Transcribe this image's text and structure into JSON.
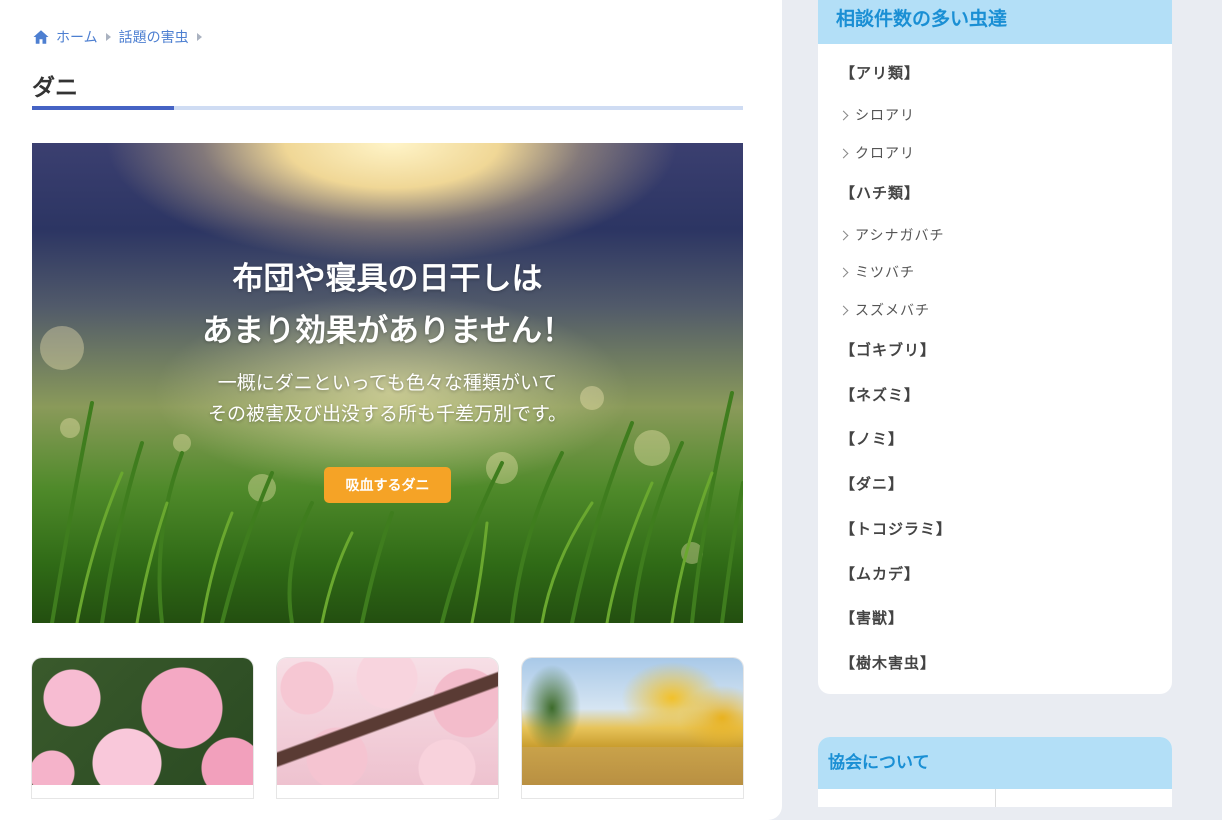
{
  "breadcrumb": {
    "home": "ホーム",
    "category": "話題の害虫"
  },
  "page": {
    "title": "ダニ"
  },
  "hero": {
    "headline_line1": "布団や寝具の日干しは",
    "headline_line2": "あまり効果がありません！",
    "sub_line1": "一概にダニといっても色々な種類がいて",
    "sub_line2": "その被害及び出没する所も千差万別です。",
    "button_label": "吸血するダニ",
    "button_color": "#f5a326"
  },
  "cards": [
    {
      "image": "pink-roses"
    },
    {
      "image": "cherry-blossoms"
    },
    {
      "image": "ginkgo-trees"
    }
  ],
  "sidebar": {
    "title": "相談件数の多い虫達",
    "items": [
      {
        "type": "category",
        "label": "【アリ類】"
      },
      {
        "type": "sub",
        "label": "シロアリ"
      },
      {
        "type": "sub",
        "label": "クロアリ"
      },
      {
        "type": "category",
        "label": "【ハチ類】"
      },
      {
        "type": "sub",
        "label": "アシナガバチ"
      },
      {
        "type": "sub",
        "label": "ミツバチ"
      },
      {
        "type": "sub",
        "label": "スズメバチ"
      },
      {
        "type": "category",
        "label": "【ゴキブリ】"
      },
      {
        "type": "category",
        "label": "【ネズミ】"
      },
      {
        "type": "category",
        "label": "【ノミ】"
      },
      {
        "type": "category",
        "label": "【ダニ】"
      },
      {
        "type": "category",
        "label": "【トコジラミ】"
      },
      {
        "type": "category",
        "label": "【ムカデ】"
      },
      {
        "type": "category",
        "label": "【害獣】"
      },
      {
        "type": "category",
        "label": "【樹木害虫】"
      }
    ]
  },
  "about": {
    "title": "協会について"
  },
  "colors": {
    "accent_blue": "#4563c4",
    "link_blue": "#4d7fd1",
    "widget_header_bg": "#b3dff7",
    "widget_header_text": "#1a8fd4"
  }
}
